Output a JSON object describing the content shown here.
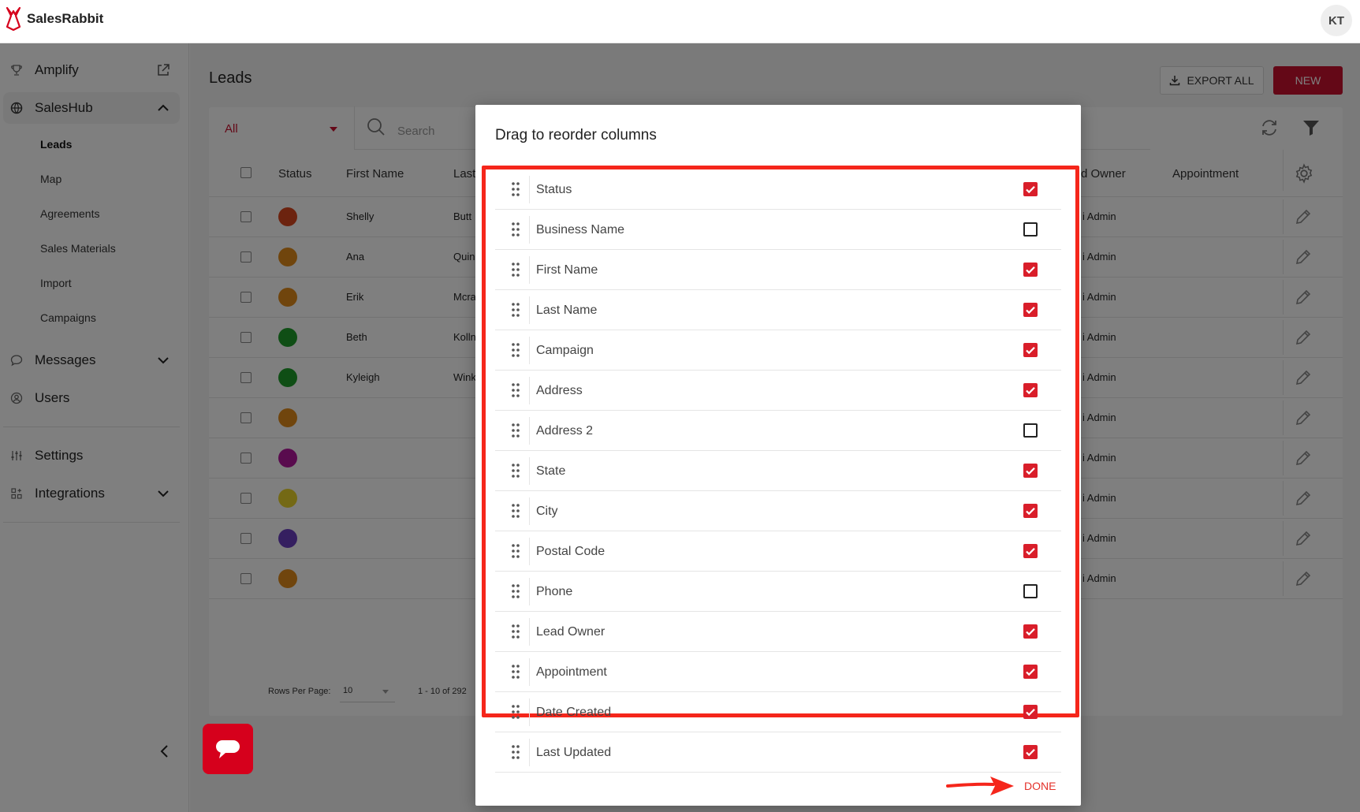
{
  "app": {
    "name": "SalesRabbit",
    "user_initials": "KT"
  },
  "sidebar": {
    "amplify": "Amplify",
    "saleshub": "SalesHub",
    "sub_items": [
      "Leads",
      "Map",
      "Agreements",
      "Sales Materials",
      "Import",
      "Campaigns"
    ],
    "messages": "Messages",
    "users": "Users",
    "settings": "Settings",
    "integrations": "Integrations"
  },
  "main": {
    "title": "Leads",
    "export_label": "EXPORT ALL",
    "new_label": "NEW",
    "filter_value": "All",
    "search_placeholder": "Search",
    "headers": {
      "status": "Status",
      "first_name": "First Name",
      "last": "Last",
      "owner": "d Owner",
      "appointment": "Appointment"
    },
    "rows": [
      {
        "first": "Shelly",
        "last": "Butt",
        "owner": "i Admin",
        "status_color": "#d9471f"
      },
      {
        "first": "Ana",
        "last": "Quin",
        "owner": "i Admin",
        "status_color": "#e08a1a"
      },
      {
        "first": "Erik",
        "last": "Mcra",
        "owner": "i Admin",
        "status_color": "#e08a1a"
      },
      {
        "first": "Beth",
        "last": "Kolln",
        "owner": "i Admin",
        "status_color": "#1f9d2a"
      },
      {
        "first": "Kyleigh",
        "last": "Wink",
        "owner": "i Admin",
        "status_color": "#1f9d2a"
      },
      {
        "first": "",
        "last": "",
        "owner": "i Admin",
        "status_color": "#e08a1a"
      },
      {
        "first": "",
        "last": "",
        "owner": "i Admin",
        "status_color": "#b3179c"
      },
      {
        "first": "",
        "last": "",
        "owner": "i Admin",
        "status_color": "#e8d22a"
      },
      {
        "first": "",
        "last": "",
        "owner": "i Admin",
        "status_color": "#6a3fc0"
      },
      {
        "first": "",
        "last": "",
        "owner": "i Admin",
        "status_color": "#e08a1a"
      }
    ],
    "rows_per_page_label": "Rows Per Page:",
    "rows_per_page_value": "10",
    "pagination": "1 - 10 of 292"
  },
  "modal": {
    "title": "Drag to reorder columns",
    "columns": [
      {
        "label": "Status",
        "checked": true
      },
      {
        "label": "Business Name",
        "checked": false
      },
      {
        "label": "First Name",
        "checked": true
      },
      {
        "label": "Last Name",
        "checked": true
      },
      {
        "label": "Campaign",
        "checked": true
      },
      {
        "label": "Address",
        "checked": true
      },
      {
        "label": "Address 2",
        "checked": false
      },
      {
        "label": "State",
        "checked": true
      },
      {
        "label": "City",
        "checked": true
      },
      {
        "label": "Postal Code",
        "checked": true
      },
      {
        "label": "Phone",
        "checked": false
      },
      {
        "label": "Lead Owner",
        "checked": true
      },
      {
        "label": "Appointment",
        "checked": true
      },
      {
        "label": "Date Created",
        "checked": true
      },
      {
        "label": "Last Updated",
        "checked": true
      }
    ],
    "done_label": "DONE"
  },
  "colors": {
    "brand_red": "#c8102e",
    "highlight": "#f5261b",
    "check_red": "#d91e2a"
  }
}
